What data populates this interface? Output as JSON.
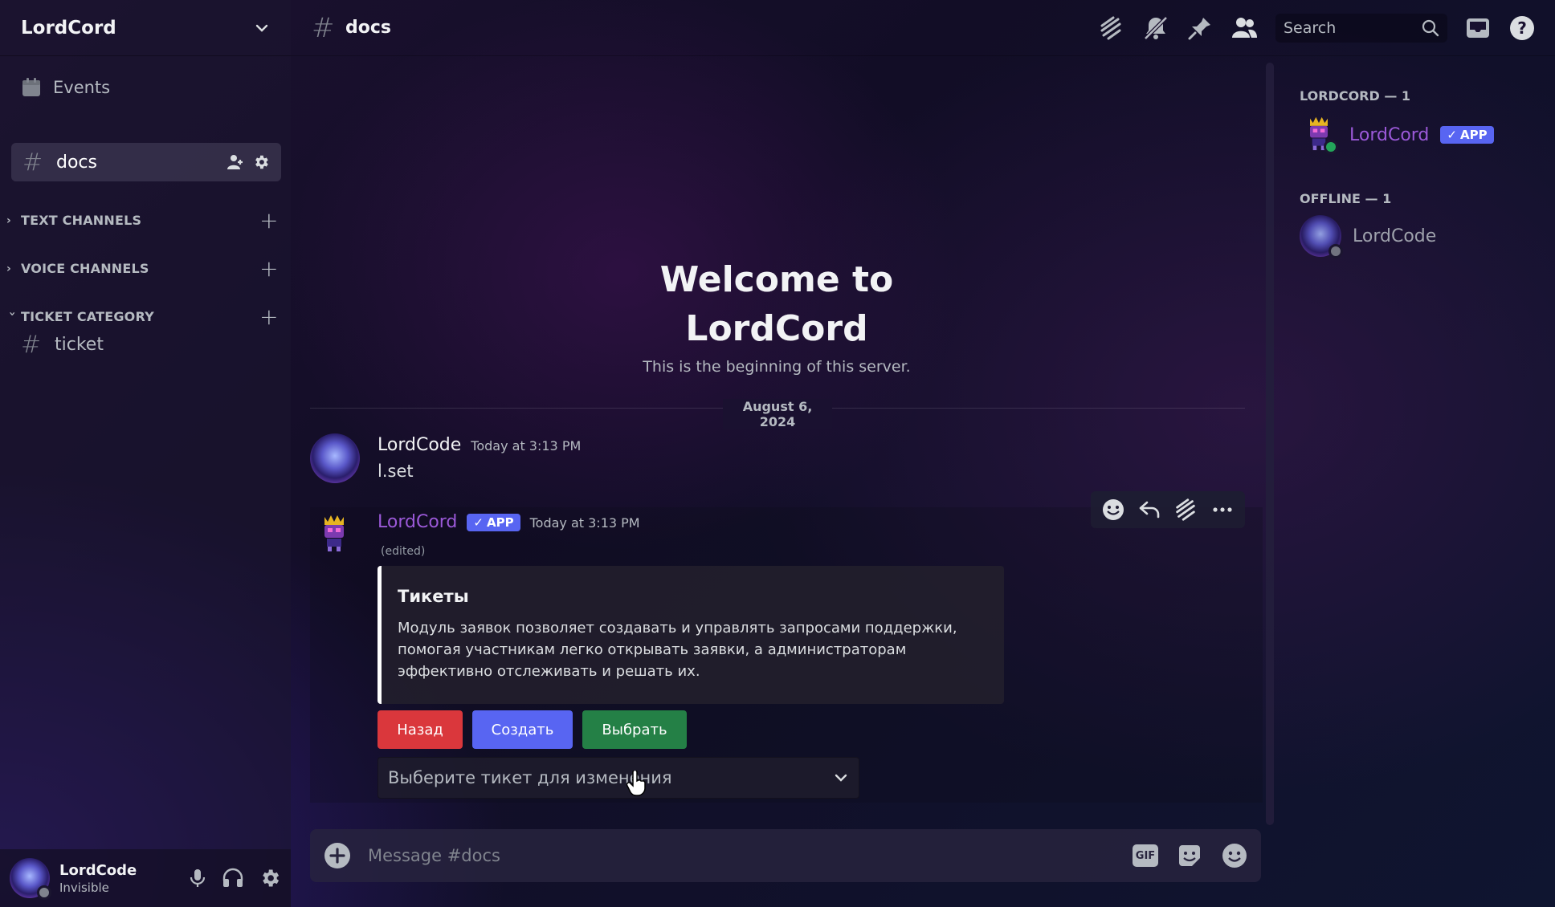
{
  "server": {
    "name": "LordCord"
  },
  "sidebar": {
    "events_label": "Events",
    "active_channel": "docs",
    "categories": [
      {
        "label": "TEXT CHANNELS",
        "expanded": false
      },
      {
        "label": "VOICE CHANNELS",
        "expanded": false
      },
      {
        "label": "TICKET CATEGORY",
        "expanded": true
      }
    ],
    "ticket_channels": [
      "ticket"
    ]
  },
  "user_panel": {
    "name": "LordCode",
    "status": "Invisible"
  },
  "topbar": {
    "channel": "docs",
    "search_placeholder": "Search"
  },
  "welcome": {
    "title_line1": "Welcome to",
    "title_line2": "LordCord",
    "subtitle": "This is the beginning of this server."
  },
  "date_divider": "August 6, 2024",
  "messages": [
    {
      "author": "LordCode",
      "timestamp": "Today at 3:13 PM",
      "text": "l.set"
    },
    {
      "author": "LordCord",
      "badge": "APP",
      "timestamp": "Today at 3:13 PM",
      "edited": "(edited)",
      "embed": {
        "title": "Тикеты",
        "description": "Модуль заявок позволяет создавать и управлять запросами поддержки, помогая участникам легко открывать заявки, а администраторам эффективно отслеживать и решать их."
      },
      "buttons": [
        {
          "label": "Назад",
          "color": "#da373c"
        },
        {
          "label": "Создать",
          "color": "#5865f2"
        },
        {
          "label": "Выбрать",
          "color": "#248046"
        }
      ],
      "select_placeholder": "Выберите тикет для изменения"
    }
  ],
  "composer": {
    "placeholder": "Message #docs",
    "gif_label": "GIF"
  },
  "members": {
    "online_header": "LORDCORD — 1",
    "online": [
      {
        "name": "LordCord",
        "badge": "APP"
      }
    ],
    "offline_header": "OFFLINE — 1",
    "offline": [
      {
        "name": "LordCode"
      }
    ]
  },
  "colors": {
    "accent": "#5865f2",
    "bot_name": "#9b59d8",
    "online": "#23a55a",
    "danger": "#da373c",
    "success": "#248046"
  }
}
